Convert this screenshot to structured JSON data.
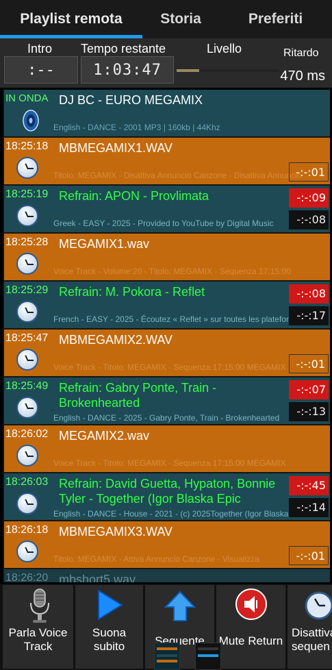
{
  "tabs": [
    "Playlist remota",
    "Storia",
    "Preferiti"
  ],
  "info": {
    "intro_label": "Intro",
    "remaining_label": "Tempo restante",
    "level_label": "Livello",
    "delay_label": "Ritardo",
    "intro_value": ":--",
    "remaining_value": "1:03:47",
    "delay_value": "470 ms",
    "level_fraction": 0.22
  },
  "rows": [
    {
      "time": "IN ONDA",
      "title": "DJ BC - EURO MEGAMIX",
      "desc": "English - DANCE - 2001 MP3 | 160kb | 44Khz",
      "cell1": "",
      "cell2": ""
    },
    {
      "time": "18:25:18",
      "title": "MBMEGAMIX1.WAV",
      "desc": "Titolo: MEGAMIX - Disattiva Annuncio Canzone - Disattiva Annuncio",
      "cell1": "",
      "cell2": "-:-:01"
    },
    {
      "time": "18:25:19",
      "title": "Refrain: APON - Provlimata",
      "desc": "Greek - EASY - 2025 - Provided to YouTube by Digital Music",
      "cell1": "-:-:09",
      "cell2": "-:-:08"
    },
    {
      "time": "18:25:28",
      "title": "MEGAMIX1.wav",
      "desc": "Voice Track - Volume:20 - Titolo: MEGAMIX - Sequenza 17:15:00",
      "cell1": "",
      "cell2": ""
    },
    {
      "time": "18:25:29",
      "title": "Refrain: M. Pokora - Reflet",
      "desc": "French - EASY - 2025 - Écoutez « Reflet » sur toutes les plateformes",
      "cell1": "-:-:08",
      "cell2": "-:-:17"
    },
    {
      "time": "18:25:47",
      "title": "MBMEGAMIX2.WAV",
      "desc": "Voice Track - Titolo: MEGAMIX - Sequenza 17:15:00 MEGAMIX",
      "cell1": "",
      "cell2": "-:-:01"
    },
    {
      "time": "18:25:49",
      "title": "Refrain: Gabry Ponte, Train - Brokenhearted",
      "desc": "English - DANCE - 2025 - Gabry Ponte, Train - Brokenhearted",
      "cell1": "-:-:07",
      "cell2": "-:-:13"
    },
    {
      "time": "18:26:02",
      "title": "MEGAMIX2.wav",
      "desc": "Voice Track - Titolo: MEGAMIX - Sequenza 17:15:00 MEGAMIX",
      "cell1": "",
      "cell2": ""
    },
    {
      "time": "18:26:03",
      "title": "Refrain: David Guetta, Hypaton, Bonnie Tyler - Together (Igor Blaska Epic",
      "desc": "English - DANCE - House - 2021 - (c) 2025Together (Igor Blaska",
      "cell1": "-:-:45",
      "cell2": "-:-:14"
    },
    {
      "time": "18:26:18",
      "title": "MBMEGAMIX3.WAV",
      "desc": "Titolo: MEGAMIX - Attiva Annuncio Canzone - Visualizza",
      "cell1": "",
      "cell2": "-:-:01"
    },
    {
      "time": "18:26:20",
      "title": "mbshort5.wav",
      "desc": "",
      "cell1": "",
      "cell2": ""
    }
  ],
  "buttons": [
    {
      "label": "Parla Voice Track",
      "icon": "microphone-icon"
    },
    {
      "label": "Suona subito",
      "icon": "play-icon"
    },
    {
      "label": "Sequente",
      "icon": "arrow-up-icon"
    },
    {
      "label": "Mute Return",
      "icon": "mute-icon"
    },
    {
      "label": "Disattiva sequen",
      "icon": "clock-icon"
    }
  ],
  "colors": {
    "accent": "#1e9be8",
    "orange_row": "#c46a0e",
    "teal_row": "#1d4a55",
    "song_title": "#32ff45",
    "alert": "#d01818"
  }
}
